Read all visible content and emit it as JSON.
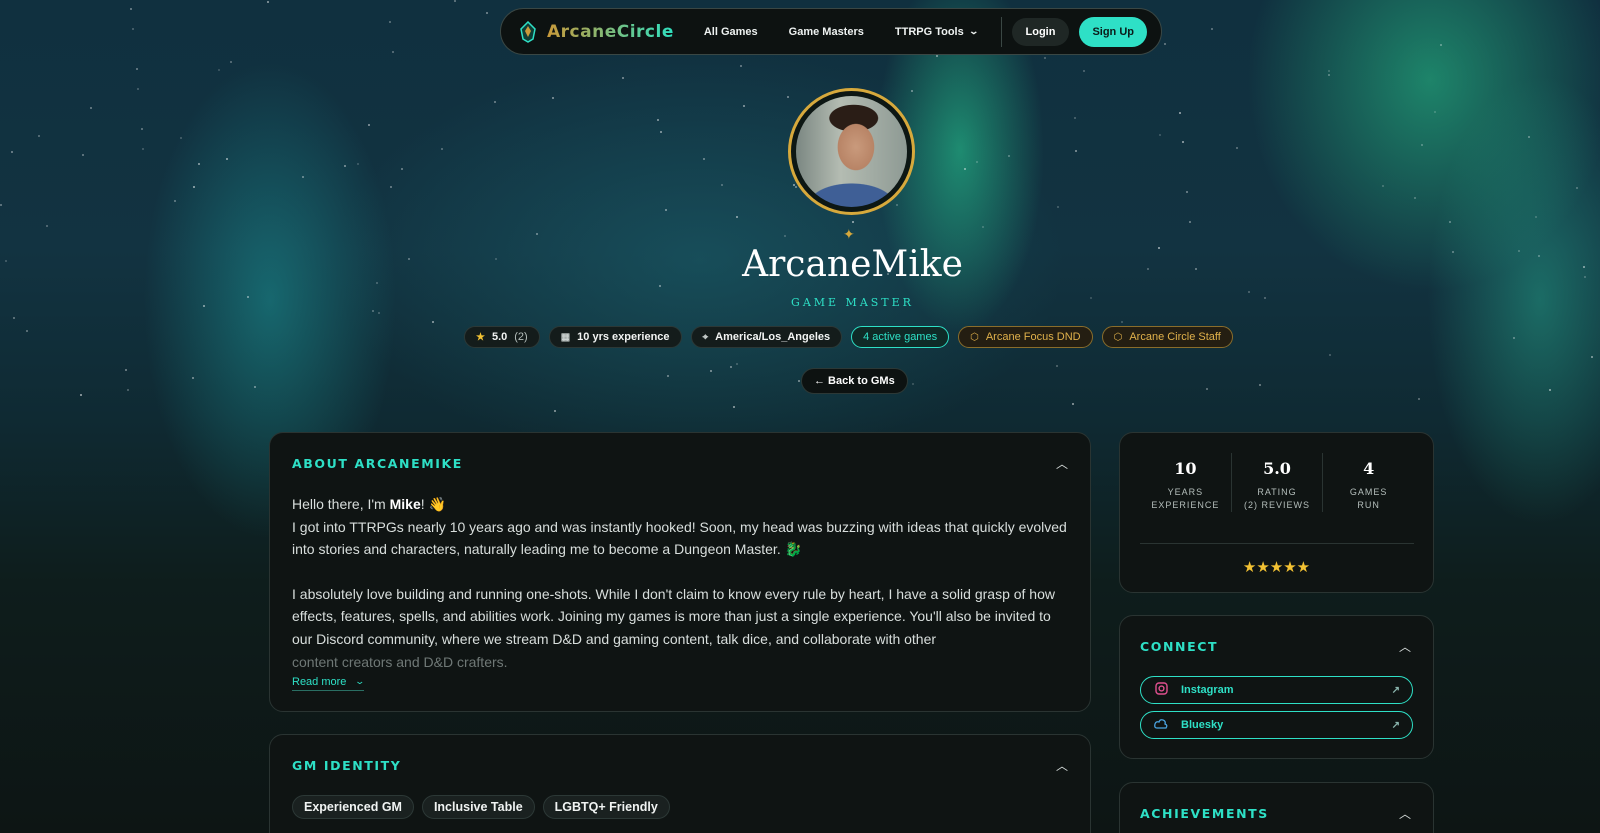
{
  "nav": {
    "logo_text": "ArcaneCircle",
    "links": [
      {
        "label": "All Games"
      },
      {
        "label": "Game Masters"
      },
      {
        "label": "TTRPG Tools"
      }
    ],
    "login_label": "Login",
    "signup_label": "Sign Up"
  },
  "profile": {
    "name": "ArcaneMike",
    "role": "GAME MASTER",
    "rating": "5.0",
    "rating_count": "(2)",
    "experience": "10 yrs experience",
    "location": "America/Los_Angeles",
    "active_games": "4 active games",
    "badge_1": "Arcane Focus DND",
    "badge_2": "Arcane Circle Staff",
    "back_label": "← Back to GMs"
  },
  "about": {
    "title": "ABOUT ARCANEMIKE",
    "greeting_pre": "Hello there, I'm ",
    "greeting_name": "Mike",
    "greeting_post": "! 👋",
    "para1": "I got into TTRPGs nearly 10 years ago and was instantly hooked! Soon, my head was buzzing with ideas that quickly evolved into stories and characters, naturally leading me to become a Dungeon Master. 🐉",
    "para2": "I absolutely love building and running one-shots. While I don't claim to know every rule by heart, I have a solid grasp of how effects, features, spells, and abilities work. Joining my games is more than just a single experience. You'll also be invited to our Discord community, where we stream D&D and gaming content, talk dice, and collaborate with other",
    "para2_fade": "content creators and D&D crafters.",
    "read_more": "Read more"
  },
  "identity": {
    "title": "GM IDENTITY",
    "tags": [
      "Experienced GM",
      "Inclusive Table",
      "LGBTQ+ Friendly"
    ]
  },
  "stats": {
    "items": [
      {
        "value": "10",
        "label_1": "YEARS",
        "label_2": "EXPERIENCE"
      },
      {
        "value": "5.0",
        "label_1": "RATING",
        "label_2": "(2) REVIEWS"
      },
      {
        "value": "4",
        "label_1": "GAMES",
        "label_2": "RUN"
      }
    ],
    "stars": "★★★★★",
    "star_rating": 5
  },
  "connect": {
    "title": "CONNECT",
    "links": [
      {
        "label": "Instagram",
        "icon": "instagram-icon"
      },
      {
        "label": "Bluesky",
        "icon": "bluesky-icon"
      }
    ]
  },
  "achievements": {
    "title": "ACHIEVEMENTS"
  },
  "colors": {
    "accent": "#2ee0c6",
    "gold": "#d7a93c",
    "card_bg": "#0f1413"
  }
}
